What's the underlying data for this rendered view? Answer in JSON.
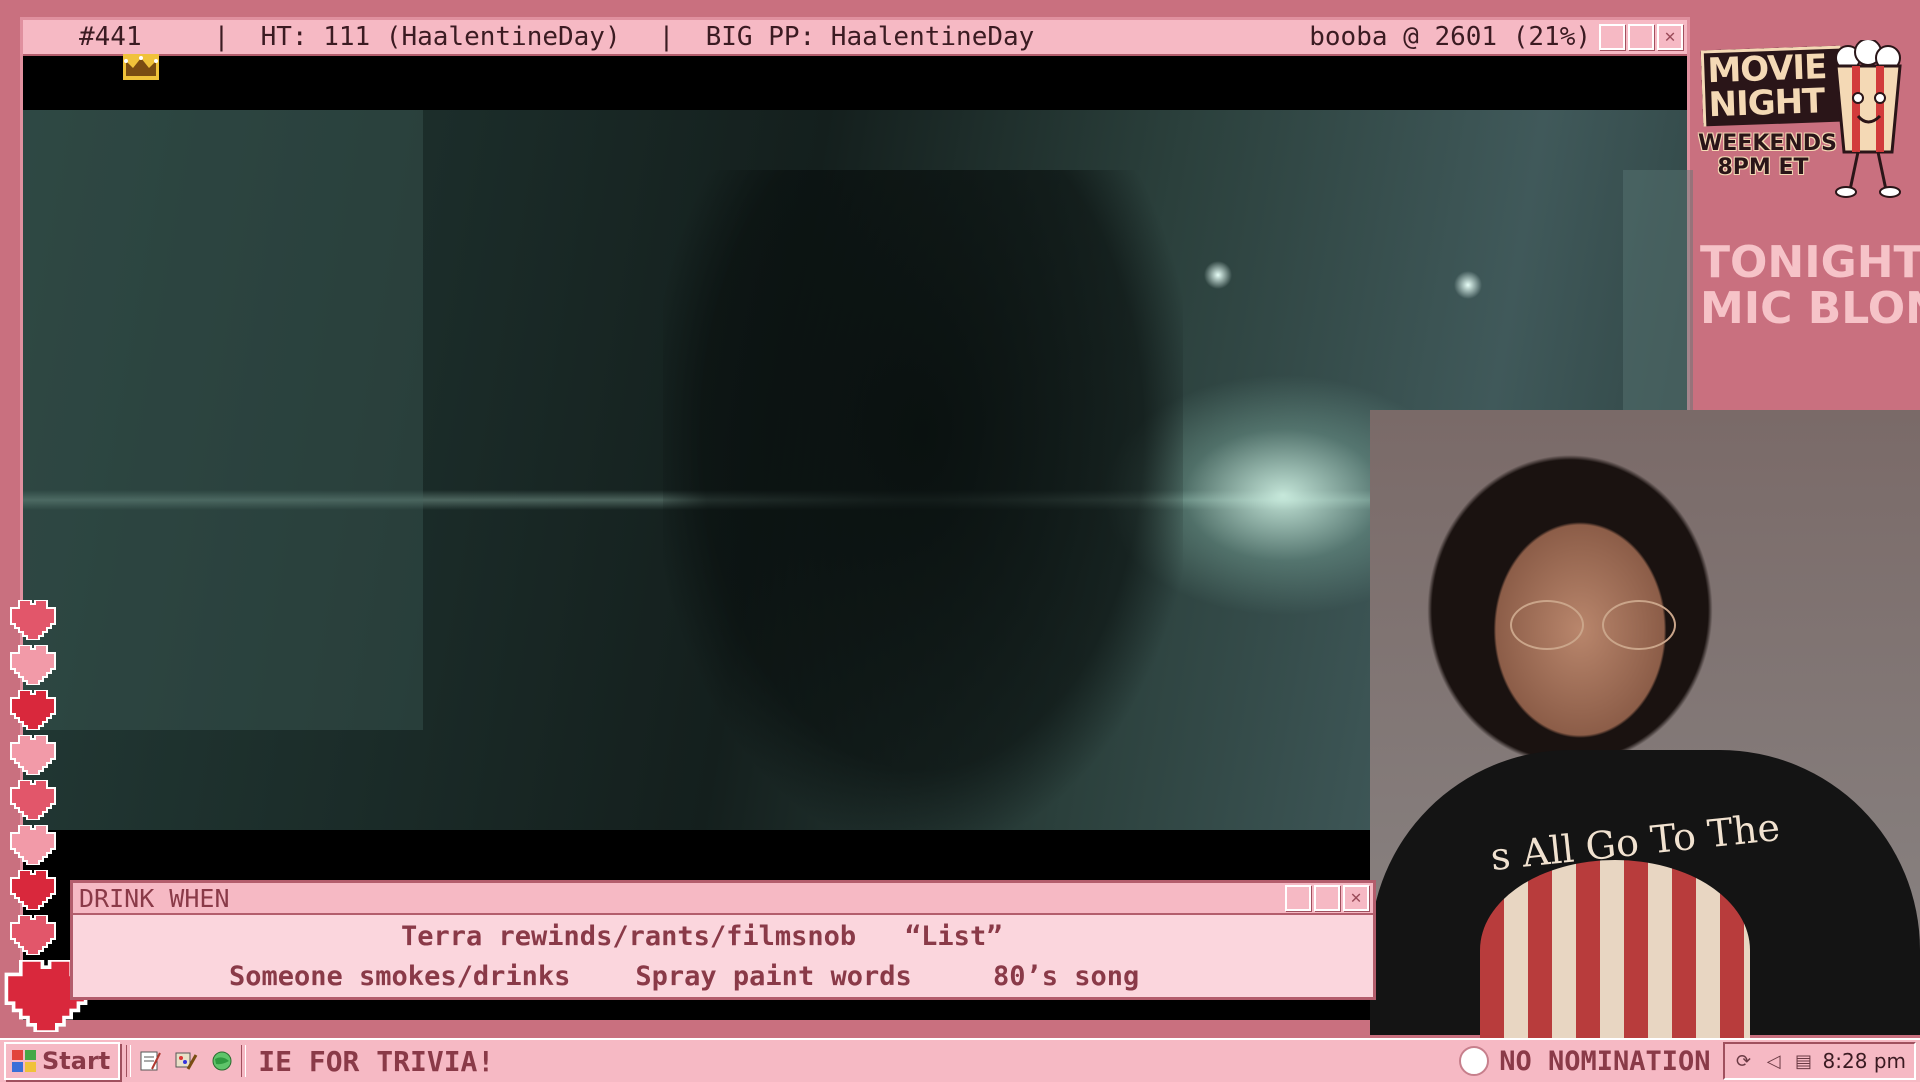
{
  "titlebar": {
    "number": "#441",
    "ht": "|  HT: 111 (HaalentineDay)",
    "bigpp": "|  BIG PP: HaalentineDay",
    "booba": "booba @ 2601 (21%)"
  },
  "logo": {
    "title": "MOVIE NIGHT",
    "subtitle_1": "WEEKENDS",
    "subtitle_2": "8PM ET"
  },
  "tonight": {
    "line1": "TONIGHT:",
    "line2": "MIC BLOND"
  },
  "drink_window": {
    "title": "DRINK WHEN",
    "line1": "Terra rewinds/rants/filmsnob   “List”",
    "line2": "Someone smokes/drinks    Spray paint words     80’s song"
  },
  "webcam": {
    "shirt_text": "s All Go To The"
  },
  "taskbar": {
    "start_label": "Start",
    "ticker": "IE FOR TRIVIA!",
    "nomination": "NO NOMINATION",
    "clock": "8:28 pm"
  },
  "colors": {
    "background": "#c9707f",
    "titlebar": "#f6b9c4",
    "drink_text": "#8a3a48",
    "heart_dark": "#d9283c",
    "heart_mid": "#e2566a",
    "heart_light": "#f29aa8"
  },
  "icons": {
    "crown": "crown-icon",
    "hearts": [
      "heart-icon",
      "heart-icon",
      "heart-icon",
      "heart-icon",
      "heart-icon",
      "heart-icon",
      "heart-icon",
      "heart-icon",
      "heart-icon"
    ],
    "popcorn": "popcorn-mascot-icon"
  }
}
